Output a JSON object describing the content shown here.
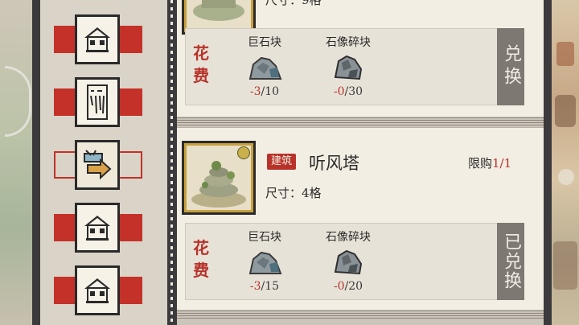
{
  "sidebar": {
    "items": [
      {
        "name": "house",
        "active": false
      },
      {
        "name": "scroll",
        "active": false
      },
      {
        "name": "exchange",
        "active": true
      },
      {
        "name": "house",
        "active": false
      },
      {
        "name": "house",
        "active": false
      }
    ]
  },
  "cards": [
    {
      "size_text": "尺寸：9格",
      "cost_label": "花费",
      "resources": [
        {
          "name": "巨石块",
          "have": "-3",
          "need": "/10",
          "icon": "boulder-icon"
        },
        {
          "name": "石像碎块",
          "have": "-0",
          "need": "/30",
          "icon": "statue-shard-icon"
        }
      ],
      "button_label": "兑换"
    },
    {
      "tag": "建筑",
      "title": "听风塔",
      "size_text": "尺寸：4格",
      "limit_label": "限购",
      "limit_value": "1/1",
      "cost_label": "花费",
      "resources": [
        {
          "name": "巨石块",
          "have": "-3",
          "need": "/15",
          "icon": "boulder-icon"
        },
        {
          "name": "石像碎块",
          "have": "-0",
          "need": "/20",
          "icon": "statue-shard-icon"
        }
      ],
      "button_label": "已兑换"
    }
  ],
  "colors": {
    "accent_red": "#b8322a",
    "frame_dark": "#3c3a3c",
    "button_grey": "#7d7872"
  }
}
